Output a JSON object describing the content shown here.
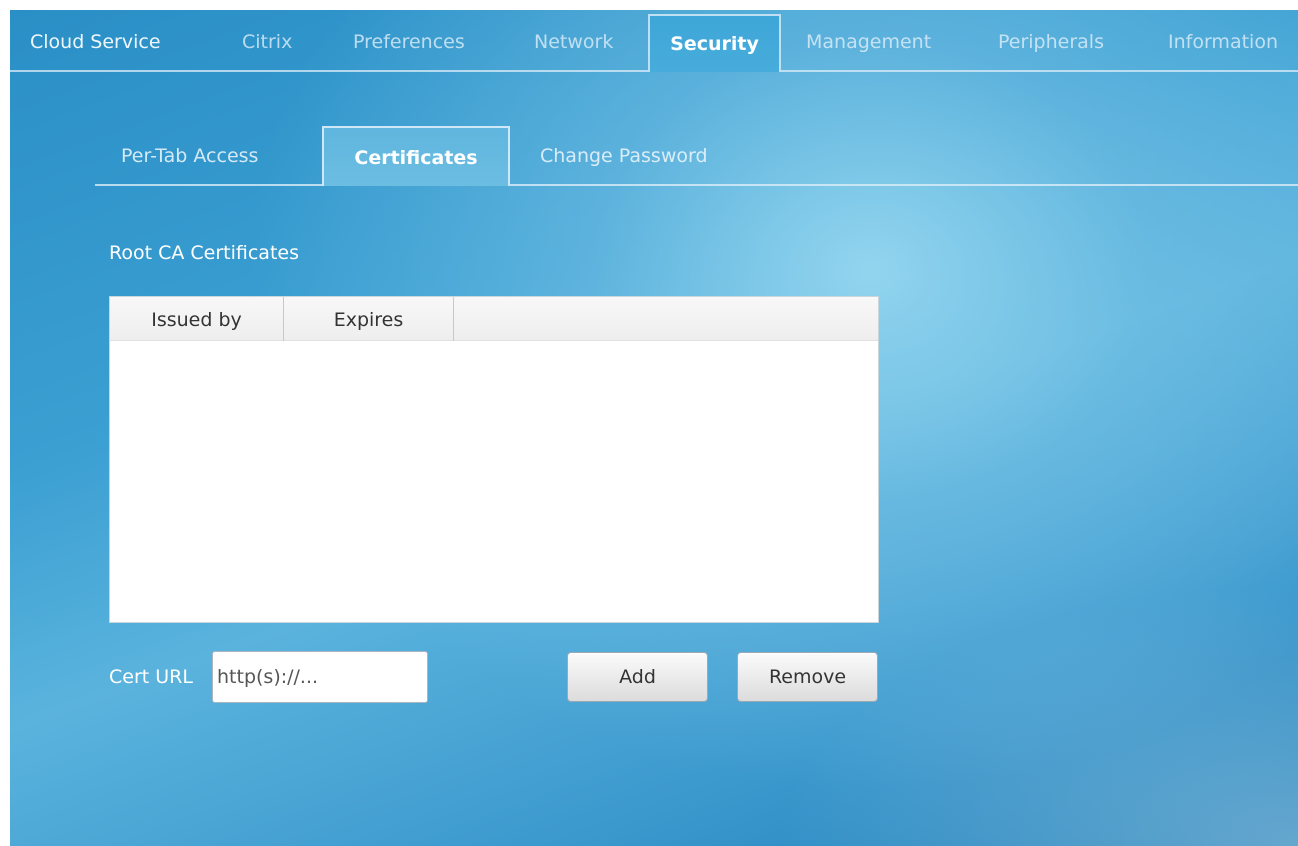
{
  "top_tabs": [
    {
      "label": "Cloud Service"
    },
    {
      "label": "Citrix"
    },
    {
      "label": "Preferences"
    },
    {
      "label": "Network"
    },
    {
      "label": "Security",
      "active": true
    },
    {
      "label": "Management"
    },
    {
      "label": "Peripherals"
    },
    {
      "label": "Information"
    }
  ],
  "sub_tabs": [
    {
      "label": "Per-Tab Access"
    },
    {
      "label": "Certificates",
      "active": true
    },
    {
      "label": "Change Password"
    }
  ],
  "certificates": {
    "section_title": "Root CA Certificates",
    "columns": [
      "Issued by",
      "Expires"
    ],
    "rows": [],
    "url_label": "Cert URL",
    "url_placeholder": "http(s)://...",
    "url_value": "",
    "add_label": "Add",
    "remove_label": "Remove"
  }
}
